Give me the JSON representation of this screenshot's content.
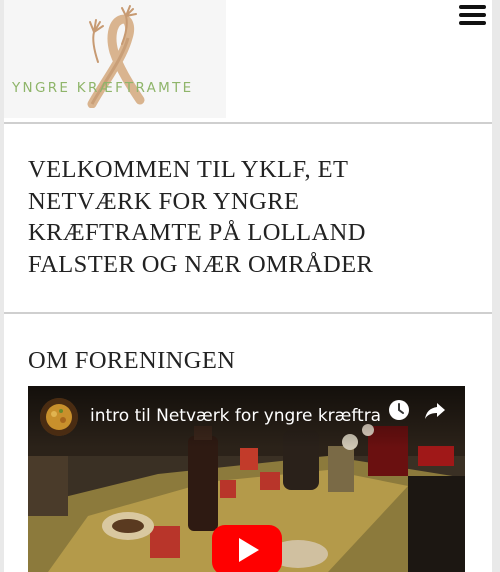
{
  "header": {
    "logo_text": "YNGRE KRÆFTRAMTE",
    "menu_icon": "hamburger-menu-icon"
  },
  "welcome": {
    "title": "VELKOMMEN TIL YKLF, ET NETVÆRK FOR YNGRE KRÆFTRAMTE PÅ LOLLAND FALSTER OG NÆR OMRÅDER"
  },
  "about": {
    "title": "OM FORENINGEN",
    "video": {
      "title": "intro til Netværk for yngre kræftra...",
      "icons": [
        "watch-later-clock-icon",
        "share-arrow-icon",
        "play-button-icon"
      ],
      "play_color": "#ff0000"
    }
  },
  "colors": {
    "logo_green": "#8fb56a",
    "logo_ribbon": "#d9b48f",
    "divider": "#cfcfcf",
    "heading_text": "#222222"
  }
}
